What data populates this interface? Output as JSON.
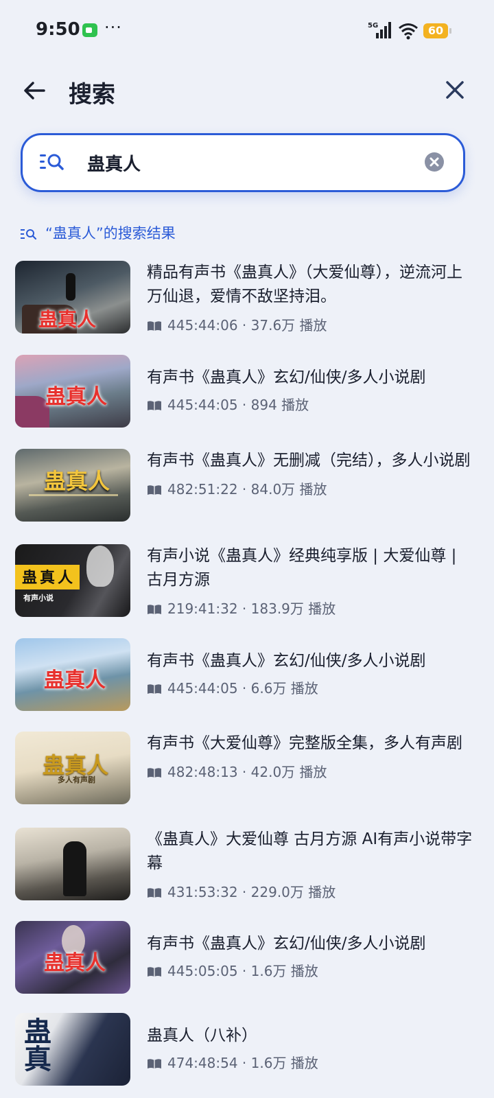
{
  "status": {
    "time": "9:50",
    "dots": "···",
    "network": "5G",
    "battery": "60"
  },
  "header": {
    "title": "搜索"
  },
  "search": {
    "value": "蛊真人"
  },
  "results": {
    "prefix": "“",
    "query": "蛊真人",
    "suffix": "”的搜索结果",
    "items": [
      {
        "title": "精品有声书《蛊真人》（大爱仙尊），逆流河上万仙退，爱情不敌坚持泪。",
        "duration": "445:44:06",
        "plays": "37.6万 播放",
        "thumb_text": "蛊真人"
      },
      {
        "title": "有声书《蛊真人》玄幻/仙侠/多人小说剧",
        "duration": "445:44:05",
        "plays": "894 播放",
        "thumb_text": "蛊真人"
      },
      {
        "title": "有声书《蛊真人》无删减（完结），多人小说剧",
        "duration": "482:51:22",
        "plays": "84.0万 播放",
        "thumb_text": "蛊真人"
      },
      {
        "title": "有声小说《蛊真人》经典纯享版 | 大爱仙尊 | 古月方源",
        "duration": "219:41:32",
        "plays": "183.9万 播放",
        "thumb_text": "蛊真人",
        "thumb_sub": "有声小说"
      },
      {
        "title": "有声书《蛊真人》玄幻/仙侠/多人小说剧",
        "duration": "445:44:05",
        "plays": "6.6万 播放",
        "thumb_text": "蛊真人"
      },
      {
        "title": "有声书《大爱仙尊》完整版全集，多人有声剧",
        "duration": "482:48:13",
        "plays": "42.0万 播放",
        "thumb_text": "蛊真人",
        "thumb_sub": "多人有声剧"
      },
      {
        "title": "《蛊真人》大爱仙尊 古月方源 AI有声小说带字幕",
        "duration": "431:53:32",
        "plays": "229.0万 播放"
      },
      {
        "title": "有声书《蛊真人》玄幻/仙侠/多人小说剧",
        "duration": "445:05:05",
        "plays": "1.6万 播放",
        "thumb_text": "蛊真人"
      },
      {
        "title": "蛊真人（八补）",
        "duration": "474:48:54",
        "plays": "1.6万 播放",
        "thumb_text": "蛊真"
      }
    ]
  },
  "colors": {
    "accent": "#2b5bd7",
    "background": "#eef1f8",
    "battery": "#f3b221",
    "thumb_title": "#e8312d"
  }
}
